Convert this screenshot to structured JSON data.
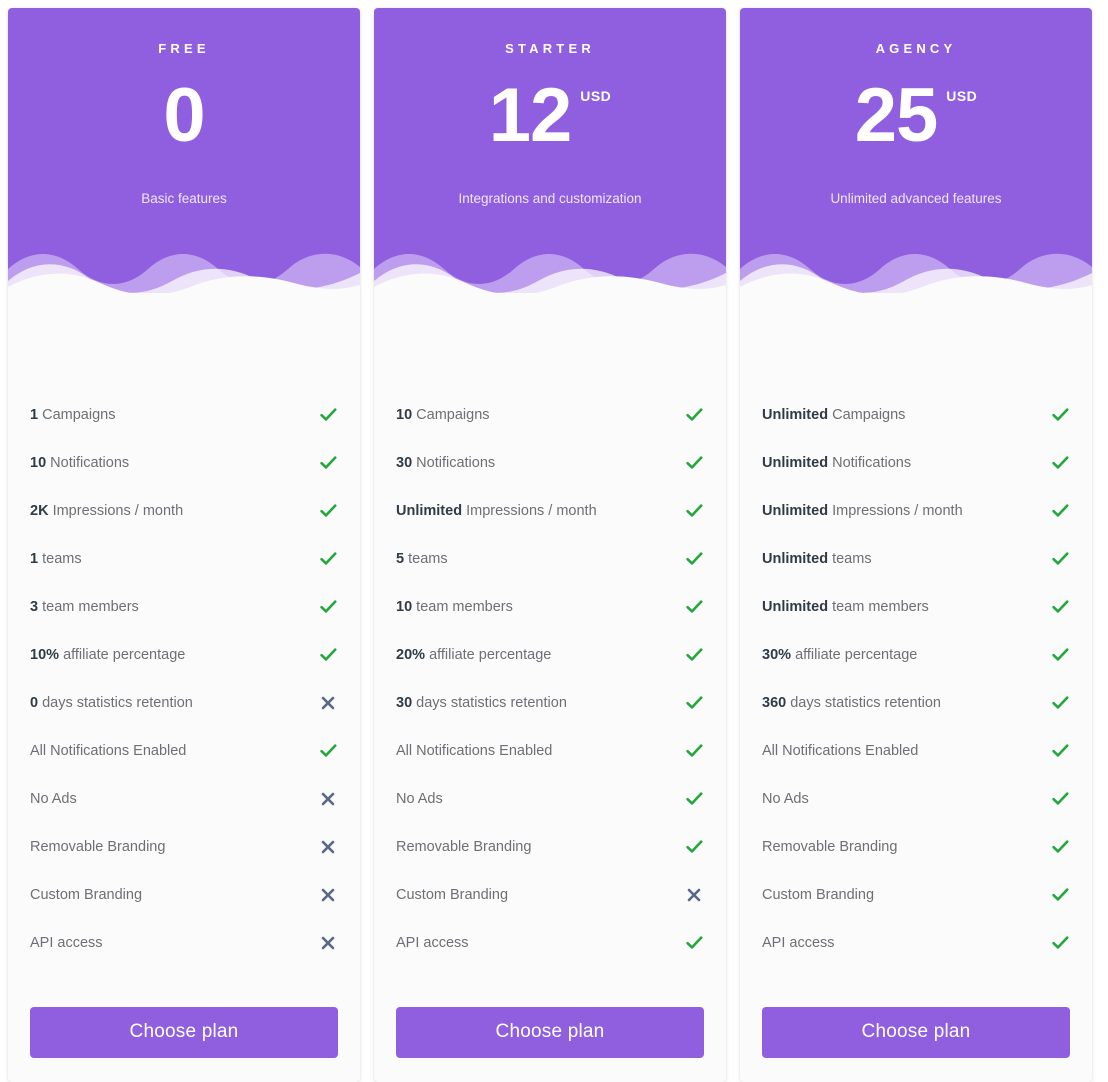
{
  "theme": {
    "brand_purple": "#8f5fe0",
    "wave_light_purple": "#c6a9f0",
    "check_green": "#22a83a",
    "cross_slate": "#56688a",
    "card_bg": "#fbfbfc",
    "feature_text": "#6d6f74",
    "feature_bold": "#2f3b47"
  },
  "icons": {
    "check": "check-icon",
    "cross": "cross-icon"
  },
  "plans": [
    {
      "name": "FREE",
      "price": "0",
      "currency": "",
      "tagline": "Basic features",
      "cta_label": "Choose plan",
      "features": [
        {
          "value": "1",
          "label": "Campaigns",
          "included": true
        },
        {
          "value": "10",
          "label": "Notifications",
          "included": true
        },
        {
          "value": "2K",
          "label": "Impressions / month",
          "included": true
        },
        {
          "value": "1",
          "label": "teams",
          "included": true
        },
        {
          "value": "3",
          "label": "team members",
          "included": true
        },
        {
          "value": "10%",
          "label": "affiliate percentage",
          "included": true
        },
        {
          "value": "0",
          "label": "days statistics retention",
          "included": false
        },
        {
          "value": "",
          "label": "All Notifications Enabled",
          "included": true
        },
        {
          "value": "",
          "label": "No Ads",
          "included": false
        },
        {
          "value": "",
          "label": "Removable Branding",
          "included": false
        },
        {
          "value": "",
          "label": "Custom Branding",
          "included": false
        },
        {
          "value": "",
          "label": "API access",
          "included": false
        }
      ]
    },
    {
      "name": "STARTER",
      "price": "12",
      "currency": "USD",
      "tagline": "Integrations and customization",
      "cta_label": "Choose plan",
      "features": [
        {
          "value": "10",
          "label": "Campaigns",
          "included": true
        },
        {
          "value": "30",
          "label": "Notifications",
          "included": true
        },
        {
          "value": "Unlimited",
          "label": "Impressions / month",
          "included": true
        },
        {
          "value": "5",
          "label": "teams",
          "included": true
        },
        {
          "value": "10",
          "label": "team members",
          "included": true
        },
        {
          "value": "20%",
          "label": "affiliate percentage",
          "included": true
        },
        {
          "value": "30",
          "label": "days statistics retention",
          "included": true
        },
        {
          "value": "",
          "label": "All Notifications Enabled",
          "included": true
        },
        {
          "value": "",
          "label": "No Ads",
          "included": true
        },
        {
          "value": "",
          "label": "Removable Branding",
          "included": true
        },
        {
          "value": "",
          "label": "Custom Branding",
          "included": false
        },
        {
          "value": "",
          "label": "API access",
          "included": true
        }
      ]
    },
    {
      "name": "AGENCY",
      "price": "25",
      "currency": "USD",
      "tagline": "Unlimited advanced features",
      "cta_label": "Choose plan",
      "features": [
        {
          "value": "Unlimited",
          "label": "Campaigns",
          "included": true
        },
        {
          "value": "Unlimited",
          "label": "Notifications",
          "included": true
        },
        {
          "value": "Unlimited",
          "label": "Impressions / month",
          "included": true
        },
        {
          "value": "Unlimited",
          "label": "teams",
          "included": true
        },
        {
          "value": "Unlimited",
          "label": "team members",
          "included": true
        },
        {
          "value": "30%",
          "label": "affiliate percentage",
          "included": true
        },
        {
          "value": "360",
          "label": "days statistics retention",
          "included": true
        },
        {
          "value": "",
          "label": "All Notifications Enabled",
          "included": true
        },
        {
          "value": "",
          "label": "No Ads",
          "included": true
        },
        {
          "value": "",
          "label": "Removable Branding",
          "included": true
        },
        {
          "value": "",
          "label": "Custom Branding",
          "included": true
        },
        {
          "value": "",
          "label": "API access",
          "included": true
        }
      ]
    }
  ]
}
